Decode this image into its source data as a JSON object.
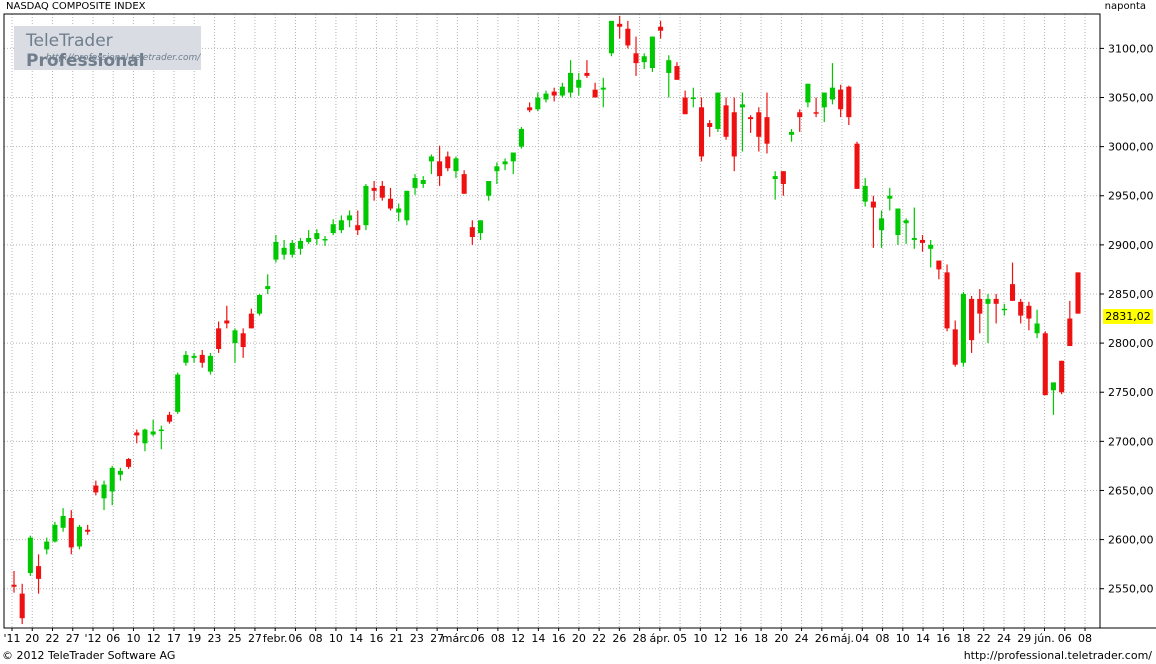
{
  "header": {
    "title": "NASDAQ COMPOSITE INDEX",
    "period": "naponta"
  },
  "logo": {
    "name_regular": "TeleTrader ",
    "name_bold": "Professional",
    "url": "http://professional.teletrader.com/"
  },
  "footer": {
    "copyright": "© 2012 TeleTrader Software AG",
    "url": "http://professional.teletrader.com/"
  },
  "colors": {
    "up": "#00c800",
    "down": "#ee1111",
    "grid": "#b4b4b4",
    "last_price_bg": "#ffff00",
    "axis_bg": "#ffffff"
  },
  "chart_data": {
    "type": "candlestick",
    "title": "NASDAQ COMPOSITE INDEX",
    "ylim": [
      2510,
      3135
    ],
    "yticks": [
      "2550,00",
      "2600,00",
      "2650,00",
      "2700,00",
      "2750,00",
      "2800,00",
      "2850,00",
      "2900,00",
      "2950,00",
      "3000,00",
      "3050,00",
      "3100,00"
    ],
    "last_price": "2831,02",
    "xticks": [
      "'11",
      "20",
      "22",
      "27",
      "'12",
      "06",
      "10",
      "12",
      "17",
      "19",
      "23",
      "25",
      "27",
      "febr.",
      "06",
      "08",
      "10",
      "14",
      "16",
      "21",
      "23",
      "27",
      "márc.",
      "06",
      "08",
      "12",
      "14",
      "16",
      "20",
      "22",
      "26",
      "28",
      "ápr.",
      "05",
      "10",
      "12",
      "16",
      "18",
      "20",
      "24",
      "26",
      "máj.",
      "04",
      "08",
      "10",
      "14",
      "16",
      "18",
      "22",
      "24",
      "29",
      "jún.",
      "06",
      "08"
    ],
    "candles": [
      [
        2554,
        2568,
        2546,
        2552
      ],
      [
        2545,
        2555,
        2514,
        2520
      ],
      [
        2566,
        2604,
        2563,
        2602
      ],
      [
        2573,
        2585,
        2545,
        2560
      ],
      [
        2590,
        2602,
        2585,
        2598
      ],
      [
        2598,
        2618,
        2597,
        2615
      ],
      [
        2612,
        2632,
        2608,
        2624
      ],
      [
        2622,
        2630,
        2585,
        2592
      ],
      [
        2593,
        2615,
        2590,
        2613
      ],
      [
        2610,
        2615,
        2605,
        2608
      ],
      [
        2655,
        2660,
        2645,
        2648
      ],
      [
        2642,
        2660,
        2630,
        2656
      ],
      [
        2649,
        2675,
        2635,
        2673
      ],
      [
        2666,
        2673,
        2660,
        2670
      ],
      [
        2682,
        2683,
        2672,
        2674
      ],
      [
        2709,
        2712,
        2698,
        2706
      ],
      [
        2698,
        2713,
        2690,
        2712
      ],
      [
        2707,
        2722,
        2705,
        2710
      ],
      [
        2712,
        2716,
        2692,
        2712
      ],
      [
        2727,
        2730,
        2718,
        2720
      ],
      [
        2730,
        2770,
        2728,
        2768
      ],
      [
        2780,
        2792,
        2777,
        2788
      ],
      [
        2785,
        2790,
        2780,
        2787
      ],
      [
        2788,
        2793,
        2775,
        2780
      ],
      [
        2771,
        2790,
        2768,
        2787
      ],
      [
        2815,
        2822,
        2790,
        2794
      ],
      [
        2823,
        2838,
        2815,
        2820
      ],
      [
        2800,
        2815,
        2780,
        2813
      ],
      [
        2810,
        2815,
        2785,
        2796
      ],
      [
        2830,
        2835,
        2815,
        2815
      ],
      [
        2830,
        2850,
        2828,
        2849
      ],
      [
        2855,
        2870,
        2850,
        2858
      ],
      [
        2885,
        2910,
        2882,
        2903
      ],
      [
        2890,
        2905,
        2885,
        2897
      ],
      [
        2890,
        2905,
        2887,
        2902
      ],
      [
        2896,
        2907,
        2890,
        2904
      ],
      [
        2903,
        2915,
        2901,
        2907
      ],
      [
        2906,
        2916,
        2900,
        2912
      ],
      [
        2905,
        2909,
        2899,
        2906
      ],
      [
        2912,
        2926,
        2910,
        2921
      ],
      [
        2915,
        2930,
        2912,
        2925
      ],
      [
        2925,
        2935,
        2918,
        2930
      ],
      [
        2920,
        2935,
        2910,
        2915
      ],
      [
        2920,
        2962,
        2915,
        2960
      ],
      [
        2958,
        2965,
        2945,
        2955
      ],
      [
        2960,
        2965,
        2945,
        2948
      ],
      [
        2947,
        2958,
        2935,
        2937
      ],
      [
        2933,
        2942,
        2924,
        2937
      ],
      [
        2925,
        2955,
        2920,
        2955
      ],
      [
        2958,
        2972,
        2951,
        2968
      ],
      [
        2962,
        2970,
        2958,
        2966
      ],
      [
        2985,
        2992,
        2972,
        2990
      ],
      [
        2985,
        3001,
        2960,
        2970
      ],
      [
        2990,
        2995,
        2975,
        2978
      ],
      [
        2975,
        2990,
        2968,
        2988
      ],
      [
        2972,
        2976,
        2955,
        2952
      ],
      [
        2918,
        2925,
        2900,
        2908
      ],
      [
        2912,
        2925,
        2905,
        2925
      ],
      [
        2950,
        2962,
        2945,
        2965
      ],
      [
        2975,
        2984,
        2962,
        2980
      ],
      [
        2982,
        2988,
        2976,
        2985
      ],
      [
        2985,
        2990,
        2972,
        2994
      ],
      [
        3000,
        3020,
        2998,
        3018
      ],
      [
        3040,
        3045,
        3035,
        3037
      ],
      [
        3038,
        3055,
        3036,
        3050
      ],
      [
        3048,
        3057,
        3045,
        3054
      ],
      [
        3056,
        3060,
        3046,
        3052
      ],
      [
        3052,
        3065,
        3050,
        3061
      ],
      [
        3055,
        3088,
        3050,
        3075
      ],
      [
        3060,
        3075,
        3052,
        3068
      ],
      [
        3075,
        3088,
        3070,
        3072
      ],
      [
        3058,
        3065,
        3052,
        3050
      ],
      [
        3058,
        3070,
        3040,
        3060
      ],
      [
        3095,
        3125,
        3092,
        3128
      ],
      [
        3125,
        3133,
        3110,
        3122
      ],
      [
        3120,
        3128,
        3100,
        3103
      ],
      [
        3095,
        3112,
        3072,
        3085
      ],
      [
        3086,
        3095,
        3079,
        3092
      ],
      [
        3080,
        3112,
        3076,
        3112
      ],
      [
        3122,
        3128,
        3110,
        3118
      ],
      [
        3075,
        3093,
        3050,
        3088
      ],
      [
        3082,
        3086,
        3069,
        3068
      ],
      [
        3050,
        3057,
        3036,
        3033
      ],
      [
        3050,
        3060,
        3040,
        3050
      ],
      [
        3040,
        3050,
        2985,
        2990
      ],
      [
        3024,
        3027,
        3010,
        3020
      ],
      [
        3018,
        3052,
        3015,
        3055
      ],
      [
        3042,
        3050,
        3007,
        3010
      ],
      [
        3035,
        3050,
        2975,
        2990
      ],
      [
        3040,
        3055,
        2995,
        3043
      ],
      [
        3030,
        3032,
        3014,
        3028
      ],
      [
        3035,
        3040,
        2995,
        3010
      ],
      [
        3030,
        3055,
        2993,
        3003
      ],
      [
        2967,
        2975,
        2946,
        2970
      ],
      [
        2975,
        2973,
        2950,
        2962
      ],
      [
        3012,
        3018,
        3005,
        3015
      ],
      [
        3035,
        3038,
        3015,
        3030
      ],
      [
        3045,
        3058,
        3040,
        3064
      ],
      [
        3035,
        3050,
        3030,
        3034
      ],
      [
        3040,
        3050,
        3025,
        3055
      ],
      [
        3048,
        3085,
        3043,
        3060
      ],
      [
        3058,
        3063,
        3030,
        3038
      ],
      [
        3061,
        3062,
        3022,
        3030
      ],
      [
        3003,
        3005,
        2958,
        2957
      ],
      [
        2944,
        2968,
        2939,
        2960
      ],
      [
        2944,
        2950,
        2897,
        2938
      ],
      [
        2915,
        2935,
        2897,
        2927
      ],
      [
        2947,
        2958,
        2935,
        2950
      ],
      [
        2910,
        2932,
        2900,
        2937
      ],
      [
        2922,
        2927,
        2901,
        2925
      ],
      [
        2905,
        2938,
        2896,
        2907
      ],
      [
        2905,
        2910,
        2893,
        2902
      ],
      [
        2896,
        2905,
        2877,
        2900
      ],
      [
        2884,
        2880,
        2865,
        2875
      ],
      [
        2872,
        2880,
        2812,
        2815
      ],
      [
        2814,
        2823,
        2776,
        2778
      ],
      [
        2780,
        2852,
        2776,
        2850
      ],
      [
        2845,
        2848,
        2790,
        2803
      ],
      [
        2845,
        2855,
        2810,
        2830
      ],
      [
        2840,
        2850,
        2800,
        2845
      ],
      [
        2845,
        2850,
        2820,
        2840
      ],
      [
        2835,
        2840,
        2828,
        2835
      ],
      [
        2860,
        2882,
        2849,
        2843
      ],
      [
        2842,
        2845,
        2820,
        2828
      ],
      [
        2838,
        2842,
        2813,
        2825
      ],
      [
        2810,
        2834,
        2805,
        2820
      ],
      [
        2810,
        2812,
        2747,
        2747
      ],
      [
        2752,
        2760,
        2727,
        2760
      ],
      [
        2782,
        2780,
        2748,
        2750
      ],
      [
        2825,
        2843,
        2797,
        2797
      ],
      [
        2872,
        2870,
        2830,
        2830
      ]
    ]
  }
}
